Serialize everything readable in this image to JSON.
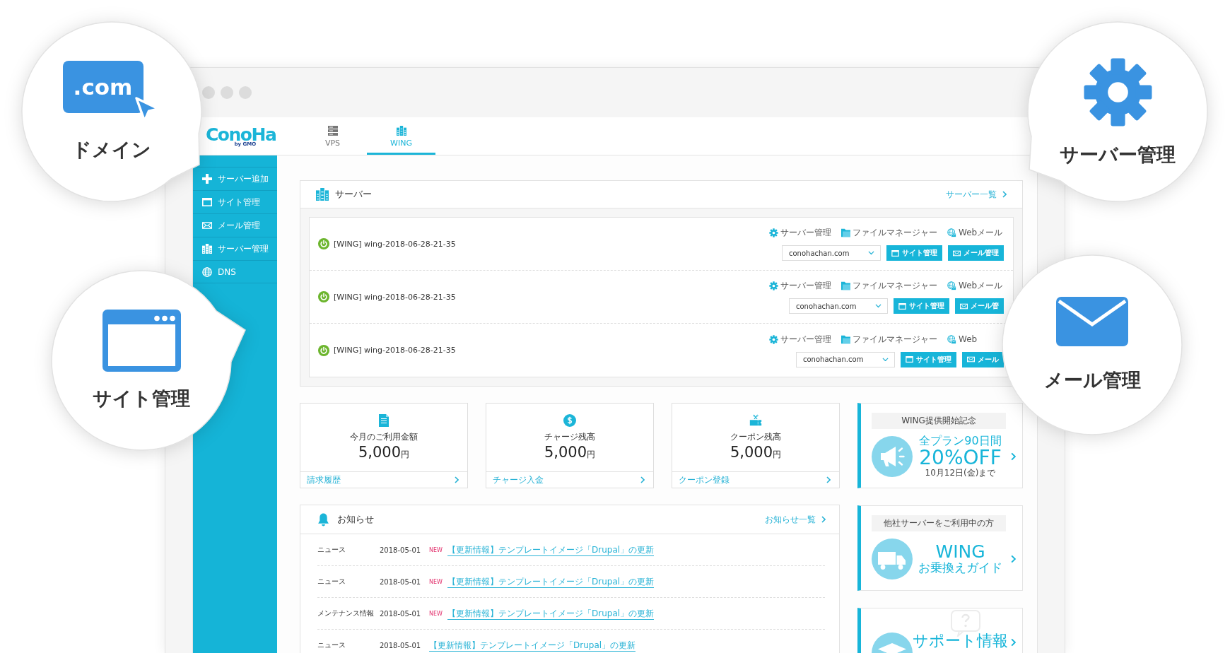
{
  "callouts": [
    {
      "kind": "domain",
      "icon_text": ".com",
      "label": "ドメイン"
    },
    {
      "kind": "site",
      "label": "サイト管理"
    },
    {
      "kind": "server",
      "label": "サーバー管理"
    },
    {
      "kind": "mail",
      "label": "メール管理"
    }
  ],
  "browser": {
    "logo": {
      "name": "ConoHa",
      "tagline": "by GMO"
    },
    "tabs": [
      {
        "kind": "vps",
        "label": "VPS",
        "selected": false
      },
      {
        "kind": "wing",
        "label": "WING",
        "selected": true
      }
    ],
    "sidebar": {
      "items": [
        {
          "kind": "add",
          "label": "サーバー追加"
        },
        {
          "kind": "site",
          "label": "サイト管理"
        },
        {
          "kind": "mail",
          "label": "メール管理"
        },
        {
          "kind": "server",
          "label": "サーバー管理"
        },
        {
          "kind": "dns",
          "label": "DNS"
        }
      ]
    },
    "server_panel": {
      "title": "サーバー",
      "link": "サーバー一覧",
      "rows": [
        {
          "name": "[WING] wing-2018-06-28-21-35",
          "running": true,
          "actions": [
            {
              "kind": "settings",
              "label": "サーバー管理"
            },
            {
              "kind": "files",
              "label": "ファイルマネージャー"
            },
            {
              "kind": "webmail",
              "label": "Webメール"
            }
          ],
          "domain": "conohachan.com",
          "buttons": [
            {
              "kind": "site",
              "label": "サイト管理"
            },
            {
              "kind": "mail",
              "label": "メール管理"
            }
          ]
        },
        {
          "name": "[WING] wing-2018-06-28-21-35",
          "running": true,
          "actions": [
            {
              "kind": "settings",
              "label": "サーバー管理"
            },
            {
              "kind": "files",
              "label": "ファイルマネージャー"
            },
            {
              "kind": "webmail",
              "label": "Webメール"
            }
          ],
          "domain": "conohachan.com",
          "buttons": [
            {
              "kind": "site",
              "label": "サイト管理"
            },
            {
              "kind": "mail",
              "label": "メール管"
            }
          ]
        },
        {
          "name": "[WING] wing-2018-06-28-21-35",
          "running": true,
          "actions": [
            {
              "kind": "settings",
              "label": "サーバー管理"
            },
            {
              "kind": "files",
              "label": "ファイルマネージャー"
            },
            {
              "kind": "webmail",
              "label": "Web"
            }
          ],
          "domain": "conohachan.com",
          "buttons": [
            {
              "kind": "site",
              "label": "サイト管理"
            },
            {
              "kind": "mail",
              "label": "メール"
            }
          ]
        }
      ]
    },
    "stats": [
      {
        "kind": "invoice",
        "label": "今月のご利用金額",
        "amount": "5,000",
        "unit": "円",
        "link": "請求履歴"
      },
      {
        "kind": "charge",
        "label": "チャージ残高",
        "amount": "5,000",
        "unit": "円",
        "link": "チャージ入金"
      },
      {
        "kind": "coupon",
        "label": "クーポン残高",
        "amount": "5,000",
        "unit": "円",
        "link": "クーポン登録"
      }
    ],
    "promos": [
      {
        "kind": "campaign",
        "heading": "WING提供開始記念",
        "lines": [
          {
            "kind": "lead",
            "text": "全プラン90日間"
          },
          {
            "kind": "headline",
            "text": "20%OFF"
          },
          {
            "kind": "note",
            "text": "10月12日(金)まで"
          }
        ]
      },
      {
        "kind": "switch",
        "heading": "他社サーバーをご利用中の方",
        "lines": [
          {
            "kind": "headline",
            "text": "WING"
          },
          {
            "kind": "lead",
            "text": "お乗換えガイド"
          }
        ]
      },
      {
        "kind": "support",
        "lines": [
          {
            "kind": "headline",
            "text": "サポート情報"
          }
        ]
      }
    ],
    "news": {
      "title": "お知らせ",
      "link": "お知らせ一覧",
      "items": [
        {
          "category": "ニュース",
          "date": "2018-05-01",
          "badge": "NEW",
          "title": "【更新情報】テンプレートイメージ「Drupal」の更新"
        },
        {
          "category": "ニュース",
          "date": "2018-05-01",
          "badge": "NEW",
          "title": "【更新情報】テンプレートイメージ「Drupal」の更新"
        },
        {
          "category": "メンテナンス情報",
          "date": "2018-05-01",
          "badge": "NEW",
          "title": "【更新情報】テンプレートイメージ「Drupal」の更新"
        },
        {
          "category": "ニュース",
          "date": "2018-05-01",
          "title": "【更新情報】テンプレートイメージ「Drupal」の更新"
        }
      ]
    }
  }
}
